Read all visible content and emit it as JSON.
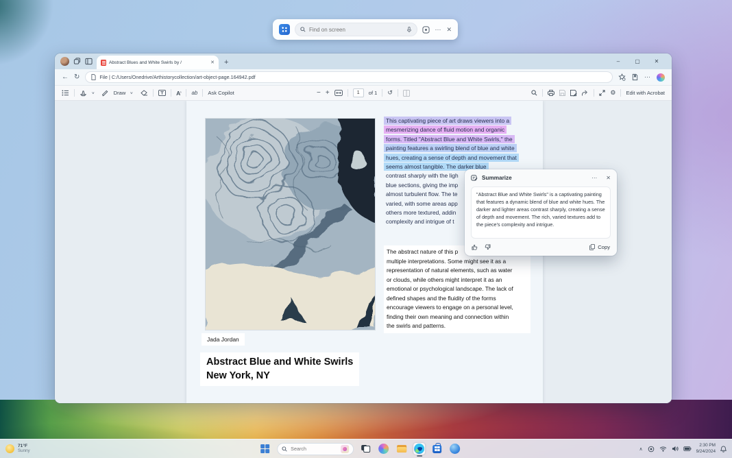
{
  "overlay": {
    "find_placeholder": "Find on screen"
  },
  "browser": {
    "tab_title": "Abstract Blues and White Swirls by /",
    "url": "File | C:/Users/Onedrive/Arthistorycollection/art-object-page.164942.pdf"
  },
  "pdf_toolbar": {
    "draw_label": "Draw",
    "ask_copilot_label": "Ask Copilot",
    "page_value": "1",
    "page_count_label": "of 1",
    "edit_with_acrobat_label": "Edit with Acrobat"
  },
  "document": {
    "highlighted_lines": [
      "This captivating piece of art draws viewers into a",
      "mesmerizing dance of fluid motion and organic",
      "forms. Titled \"Abstract Blue and White Swirls,\" the",
      "painting features a swirling blend of blue and white",
      "hues, creating a sense of depth and movement that",
      "seems almost tangible. The darker blue",
      "contrast sharply with the ligh",
      "blue sections, giving the imp",
      "almost turbulent flow. The te",
      "varied, with some areas app",
      "others more textured, addin",
      "complexity and intrigue of t"
    ],
    "paragraph_lines": [
      "The abstract nature of this p",
      "multiple interpretations. Some might see it as a",
      "representation of natural elements, such as water",
      "or clouds, while others might interpret it as an",
      "emotional or psychological landscape. The lack of",
      "defined shapes and the fluidity of the forms",
      "encourage viewers to engage on a personal level,",
      "finding their own meaning and connection within",
      "the swirls and patterns."
    ],
    "artist_name": "Jada Jordan",
    "title": "Abstract Blue and White Swirls",
    "subtitle": "New York, NY"
  },
  "summarize_popup": {
    "title": "Summarize",
    "body": "\"Abstract Blue and White Swirls\" is a captivating painting that features a dynamic blend of blue and white hues. The darker and lighter areas contrast sharply, creating a sense of depth and movement. The rich, varied textures add to the piece's complexity and intrigue.",
    "copy_label": "Copy"
  },
  "taskbar": {
    "weather_temp": "71°F",
    "weather_condition": "Sunny",
    "search_placeholder": "Search",
    "time": "2:30 PM",
    "date": "9/24/2024"
  },
  "colors": {
    "copilot_accent": "#7b6cf0",
    "highlight_purple": "#e2b4f4",
    "highlight_blue": "#b3d9f6",
    "edge_blue": "#0a58c8",
    "pdf_icon_red": "#e8453c",
    "taskbar_bg": "#edf4fa"
  }
}
